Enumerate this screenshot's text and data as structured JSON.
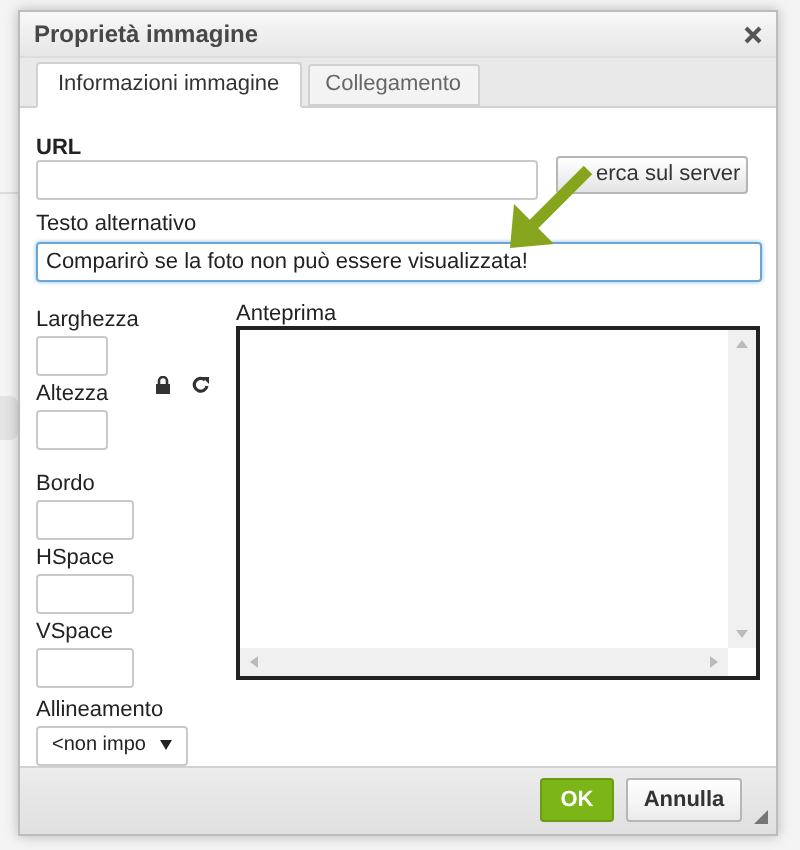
{
  "dialog": {
    "title": "Proprietà immagine"
  },
  "tabs": [
    {
      "label": "Informazioni immagine",
      "selected": true
    },
    {
      "label": "Collegamento",
      "selected": false
    }
  ],
  "url": {
    "label": "URL",
    "browse_button": "erca sul server"
  },
  "alt_text": {
    "label": "Testo alternativo",
    "value": "Comparirò se la foto non può essere visualizzata!",
    "focused": true
  },
  "size_fields": [
    {
      "label": "Larghezza"
    },
    {
      "label": "Altezza"
    }
  ],
  "spacing_fields": [
    {
      "label": "Bordo"
    },
    {
      "label": "HSpace"
    },
    {
      "label": "VSpace"
    }
  ],
  "alignment": {
    "label": "Allineamento",
    "value": "<non impo"
  },
  "preview": {
    "label": "Anteprima"
  },
  "buttons": [
    {
      "label": "OK",
      "kind": "primary"
    },
    {
      "label": "Annulla",
      "kind": "secondary"
    }
  ]
}
